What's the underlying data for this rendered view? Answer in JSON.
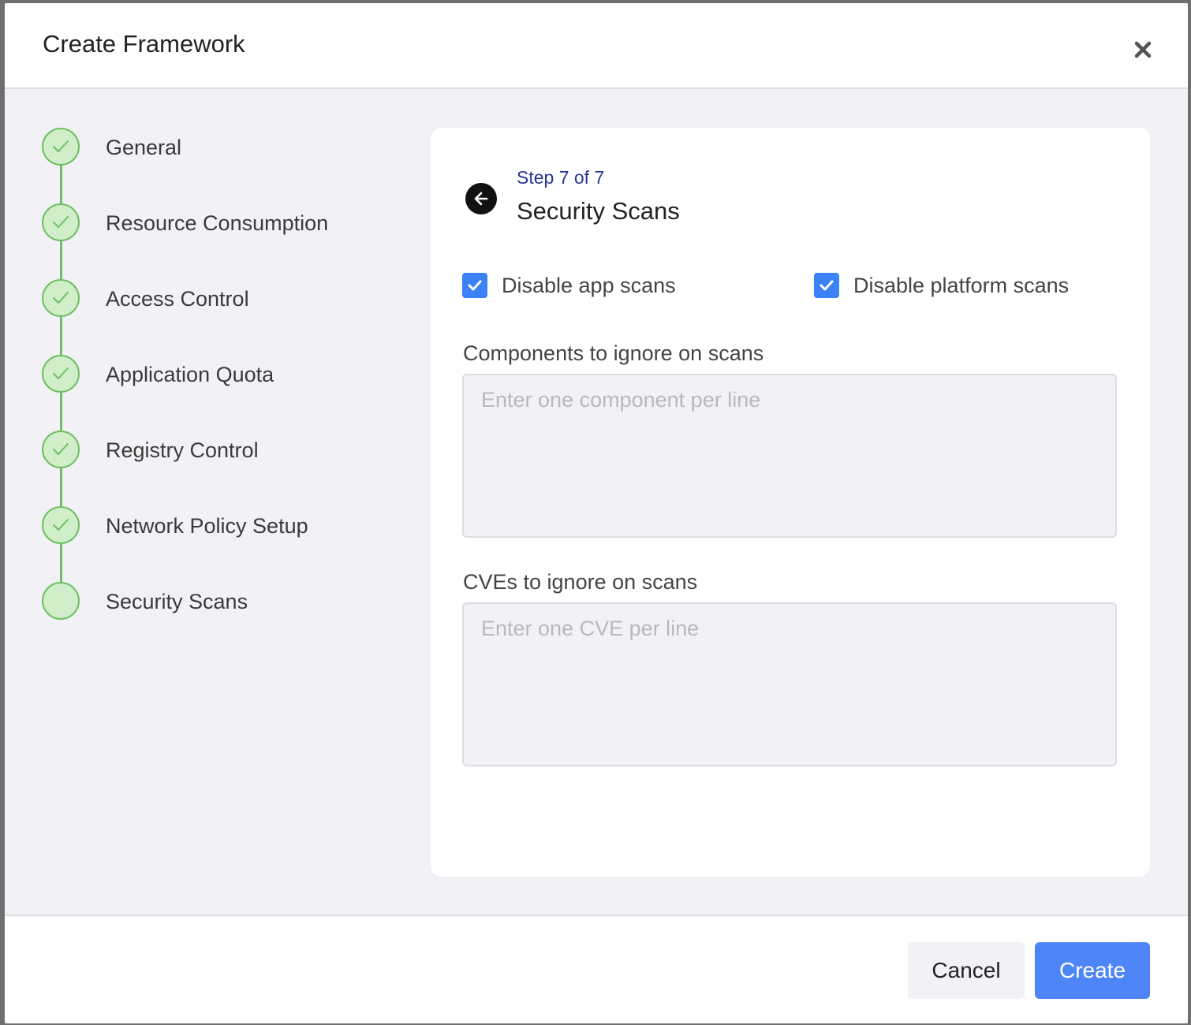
{
  "modal": {
    "title": "Create Framework"
  },
  "stepper": {
    "steps": [
      {
        "label": "General",
        "completed": true
      },
      {
        "label": "Resource Consumption",
        "completed": true
      },
      {
        "label": "Access Control",
        "completed": true
      },
      {
        "label": "Application Quota",
        "completed": true
      },
      {
        "label": "Registry Control",
        "completed": true
      },
      {
        "label": "Network Policy Setup",
        "completed": true
      },
      {
        "label": "Security Scans",
        "completed": false
      }
    ]
  },
  "card": {
    "step_indicator": "Step 7 of 7",
    "title": "Security Scans",
    "checkboxes": {
      "disable_app_scans": {
        "label": "Disable app scans",
        "checked": true
      },
      "disable_platform_scans": {
        "label": "Disable platform scans",
        "checked": true
      }
    },
    "components_field": {
      "label": "Components to ignore on scans",
      "placeholder": "Enter one component per line",
      "value": ""
    },
    "cves_field": {
      "label": "CVEs to ignore on scans",
      "placeholder": "Enter one CVE per line",
      "value": ""
    }
  },
  "footer": {
    "cancel_label": "Cancel",
    "create_label": "Create"
  },
  "colors": {
    "step_complete_fill": "#cfeec9",
    "step_complete_stroke": "#6fbf62",
    "accent_blue": "#4f86f7",
    "checkbox_blue": "#3b82f6",
    "step_indicator": "#283593"
  },
  "icons": {
    "close": "close-icon",
    "back": "arrow-left-circle-icon",
    "step_done": "checkmark-icon",
    "checkbox": "checkmark-icon"
  }
}
